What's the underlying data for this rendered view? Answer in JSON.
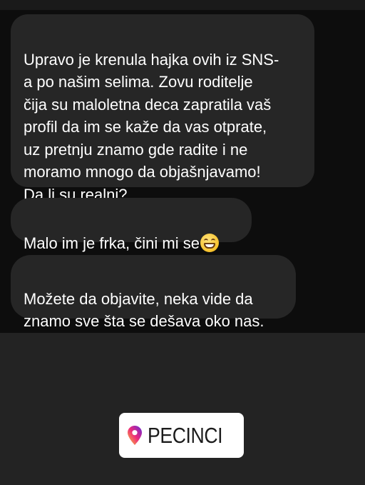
{
  "messages": [
    {
      "text": "Upravo je krenula hajka ovih iz SNS-\na po našim selima. Zovu roditelje\nčija su maloletna deca zapratila vaš\nprofil da im se kaže da vas otprate,\nuz pretnju znamo gde radite i ne\nmoramo mnogo da objašnjavamo!\nDa li su realni?"
    },
    {
      "text": "Malo im je frka, čini mi se",
      "emoji": "grinning-face-with-smiling-eyes-icon"
    },
    {
      "text": "Možete da objavite, neka vide da\nznamo sve šta se dešava oko nas."
    }
  ],
  "location_sticker": {
    "label": "PECINCI",
    "icon": "location-pin-icon",
    "icon_colors": [
      "#f9ce34",
      "#ee2a7b",
      "#6228d7"
    ]
  },
  "colors": {
    "chat_background": "#0d0d0d",
    "bubble_background": "#262626",
    "bubble_text": "#ffffff",
    "story_background": "#232323",
    "sticker_background": "#ffffff"
  }
}
